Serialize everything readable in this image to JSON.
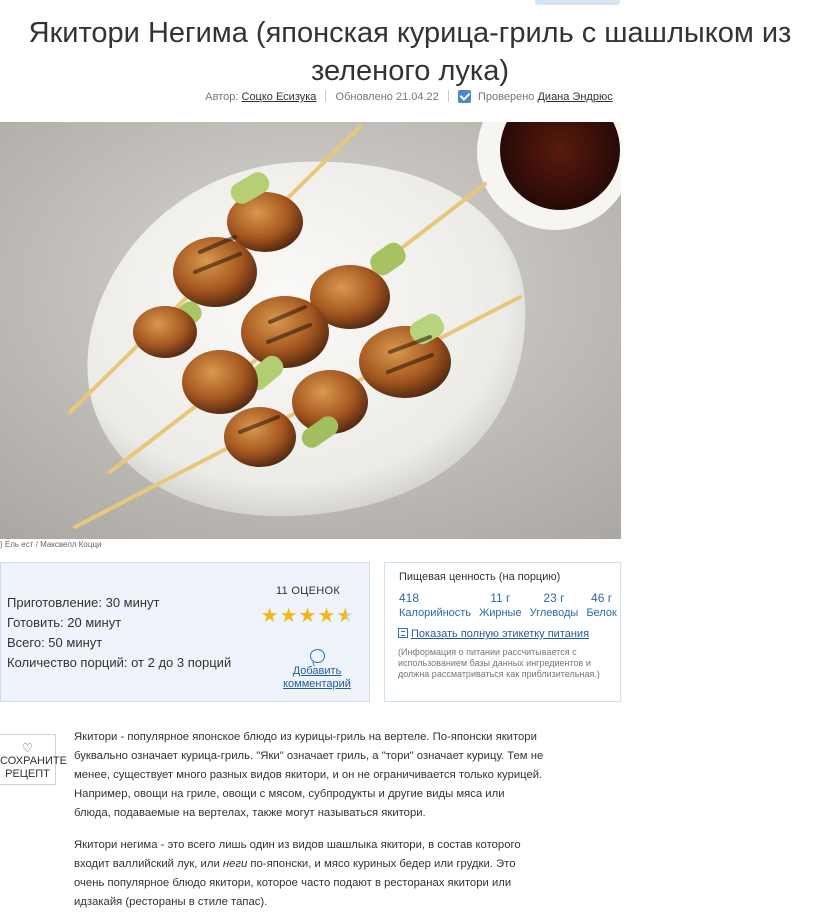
{
  "title": "Якитори Негима (японская курица-гриль с шашлыком из зеленого лука)",
  "byline": {
    "author_prefix": "Автор:",
    "author": "Соцко Есизука",
    "updated": "Обновлено 21.04.22",
    "verified_prefix": "Проверено",
    "verifier": "Диана Эндрюс"
  },
  "image": {
    "credit": ") Ель ест / Максвелл Коцци"
  },
  "times": {
    "prep": "Приготовление: 30 минут",
    "cook": "Готовить: 20 минут",
    "total": "Всего: 50 минут",
    "servings": "Количество порций: от 2 до 3 порций"
  },
  "rating": {
    "count_label": "11 ОЦЕНОК",
    "stars": "★★★★★",
    "value": 4.5,
    "comment_label": "Добавить комментарий"
  },
  "nutrition": {
    "header": "Пищевая ценность (на порцию)",
    "items": [
      {
        "value": "418",
        "label": "Калорийность"
      },
      {
        "value": "11 г",
        "label": "Жирные"
      },
      {
        "value": "23 г",
        "label": "Углеводы"
      },
      {
        "value": "46 г",
        "label": "Белок"
      }
    ],
    "link": "Показать полную этикетку питания",
    "note": "(Информация о питании рассчитывается с использованием базы данных ингредиентов и должна рассматриваться как приблизительная.)"
  },
  "save": {
    "label": "СОХРАНИТЕ РЕЦЕПТ"
  },
  "article": {
    "p1": "Якитори - популярное японское блюдо из курицы-гриль на вертеле. По-японски якитори буквально означает курица-гриль. \"Яки\" означает гриль, а \"тори\" означает курицу. Тем не менее, существует много разных видов якитори, и он не ограничивается только курицей. Например, овощи на гриле, овощи с мясом, субпродукты и другие виды мяса или блюда, подаваемые на вертелах, также могут называться якитори.",
    "p2_a": "Якитори негима - это всего лишь один из видов шашлыка якитори, в состав которого входит валлийский лук, или ",
    "p2_em": "неги",
    "p2_b": " по-японски, и мясо куриных бедер или грудки. Это очень популярное блюдо якитори, которое часто подают в ресторанах якитори или идзакайя (рестораны в стиле тапас)."
  },
  "colors": {
    "link": "#1f5c9c",
    "star": "#f3b61b",
    "panel_bg": "#eef4fa"
  }
}
